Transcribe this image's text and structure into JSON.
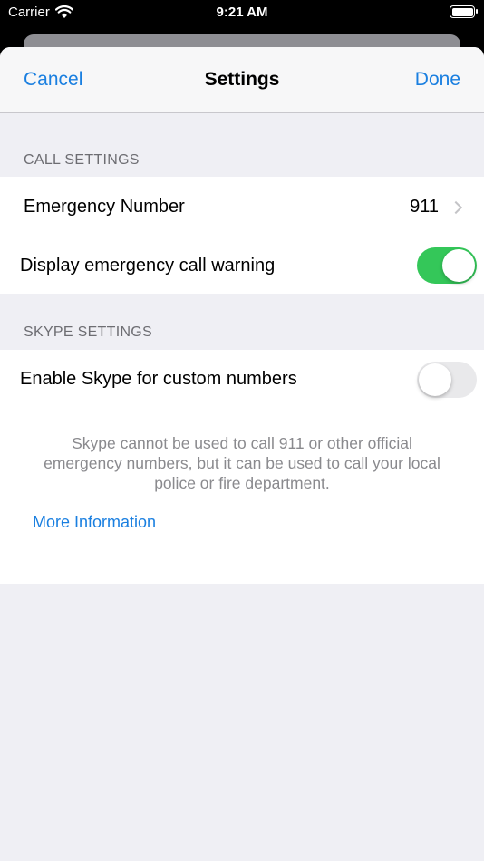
{
  "status_bar": {
    "carrier": "Carrier",
    "time": "9:21 AM",
    "wifi_icon": "wifi-icon",
    "battery_icon": "battery-icon"
  },
  "nav": {
    "cancel_label": "Cancel",
    "title": "Settings",
    "done_label": "Done"
  },
  "call_settings": {
    "header": "CALL SETTINGS",
    "emergency_number_label": "Emergency Number",
    "emergency_number_value": "911",
    "warning_label": "Display emergency call warning",
    "warning_enabled": true
  },
  "skype_settings": {
    "header": "SKYPE SETTINGS",
    "custom_numbers_label": "Enable Skype for custom numbers",
    "custom_numbers_enabled": false,
    "footer_text": "Skype cannot be used to call 911 or other official emergency numbers, but it can be used to call your local police or fire department.",
    "more_info_label": "More Information"
  },
  "colors": {
    "accent": "#1a7fe0",
    "toggle_on": "#34c759",
    "toggle_off": "#e9e9eb",
    "background": "#efeff4"
  }
}
